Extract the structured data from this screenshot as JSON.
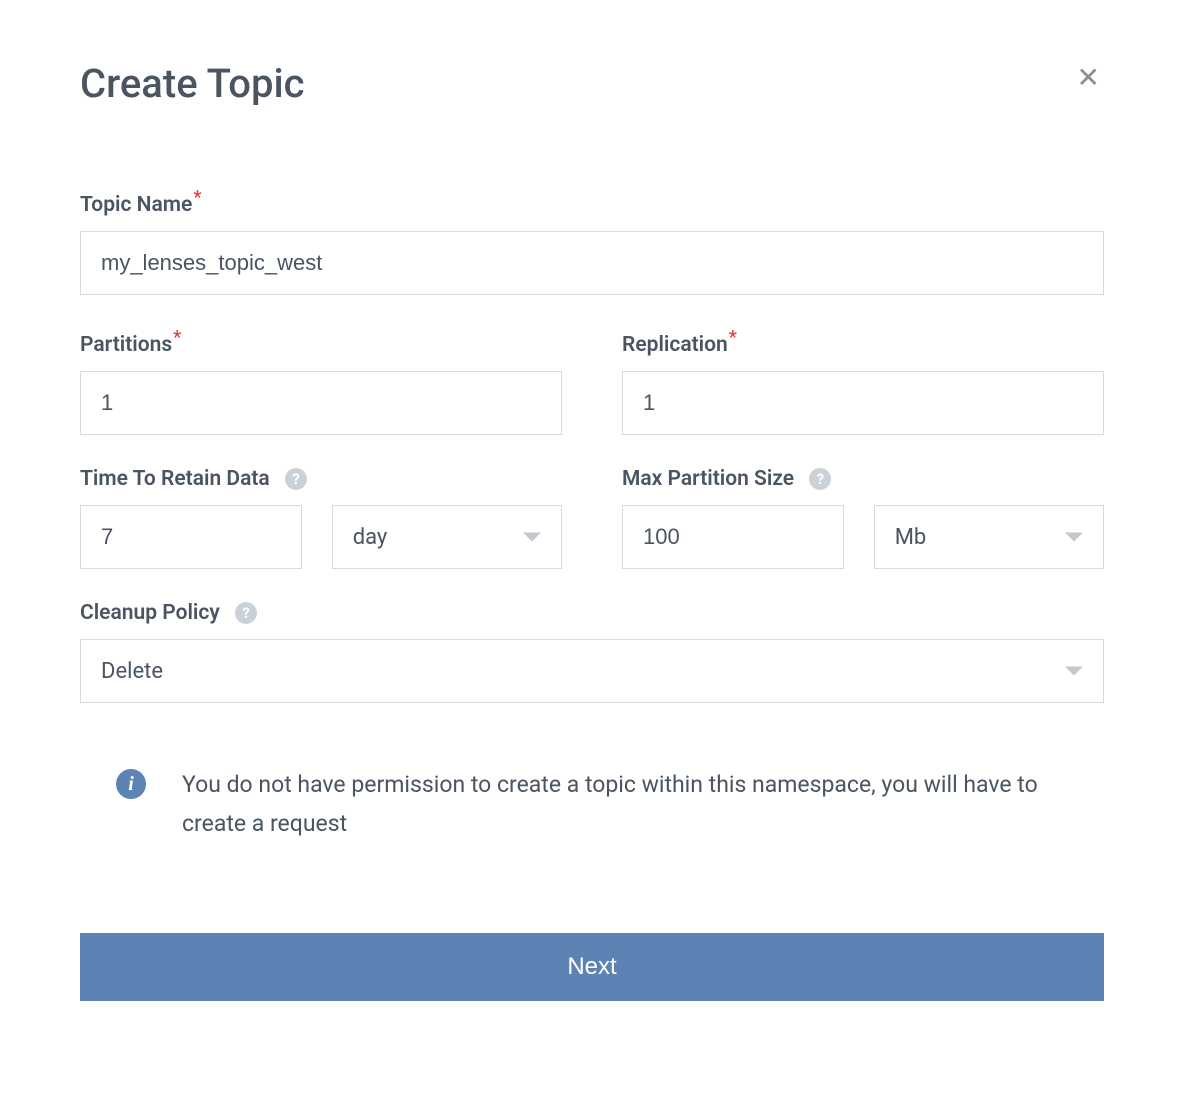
{
  "dialog": {
    "title": "Create Topic"
  },
  "fields": {
    "topicName": {
      "label": "Topic Name",
      "value": "my_lenses_topic_west"
    },
    "partitions": {
      "label": "Partitions",
      "value": "1"
    },
    "replication": {
      "label": "Replication",
      "value": "1"
    },
    "timeToRetain": {
      "label": "Time To Retain Data",
      "value": "7",
      "unit": "day"
    },
    "maxPartitionSize": {
      "label": "Max Partition Size",
      "value": "100",
      "unit": "Mb"
    },
    "cleanupPolicy": {
      "label": "Cleanup Policy",
      "selected": "Delete"
    }
  },
  "info": {
    "message": "You do not have permission to create a topic within this namespace, you will have to create a request"
  },
  "actions": {
    "next": "Next"
  }
}
